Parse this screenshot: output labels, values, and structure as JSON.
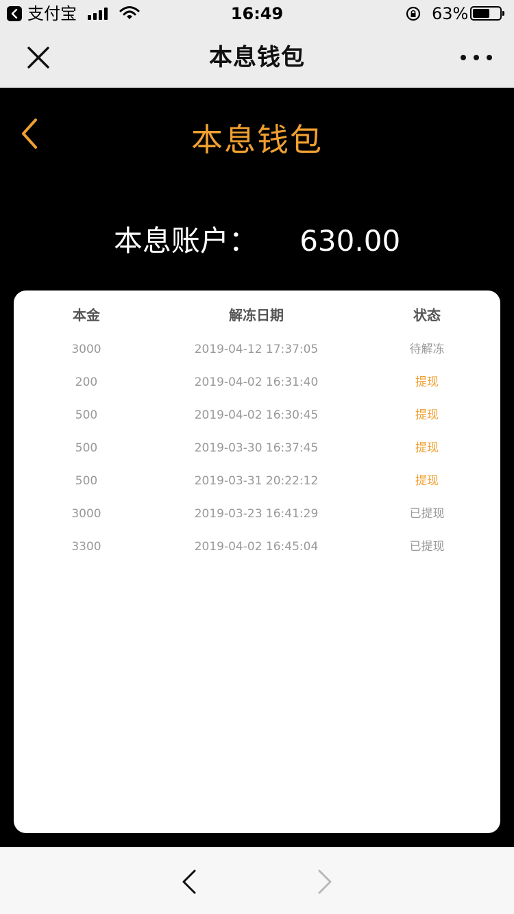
{
  "status_bar": {
    "app_name": "支付宝",
    "time": "16:49",
    "battery_percent": "63%",
    "battery_level": 0.63
  },
  "nav": {
    "title": "本息钱包"
  },
  "page": {
    "title": "本息钱包",
    "account_label": "本息账户：",
    "account_value": "630.00"
  },
  "table": {
    "headers": [
      "本金",
      "解冻日期",
      "状态"
    ],
    "rows": [
      {
        "principal": "3000",
        "date": "2019-04-12 17:37:05",
        "status": "待解冻",
        "status_color": "#999999"
      },
      {
        "principal": "200",
        "date": "2019-04-02 16:31:40",
        "status": "提现",
        "status_color": "#f0a030"
      },
      {
        "principal": "500",
        "date": "2019-04-02 16:30:45",
        "status": "提现",
        "status_color": "#f0a030"
      },
      {
        "principal": "500",
        "date": "2019-03-30 16:37:45",
        "status": "提现",
        "status_color": "#f0a030"
      },
      {
        "principal": "500",
        "date": "2019-03-31 20:22:12",
        "status": "提现",
        "status_color": "#f0a030"
      },
      {
        "principal": "3000",
        "date": "2019-03-23 16:41:29",
        "status": "已提现",
        "status_color": "#999999"
      },
      {
        "principal": "3300",
        "date": "2019-04-02 16:45:04",
        "status": "已提现",
        "status_color": "#999999"
      }
    ]
  },
  "colors": {
    "accent": "#f0a030",
    "page_background": "#000000",
    "bar_background": "#ececec"
  },
  "icons": {
    "status_back": "back-to-app-icon",
    "close": "close-icon",
    "more": "more-icon",
    "page_back": "chevron-left-icon",
    "browser_back": "browser-back-icon",
    "browser_forward": "browser-forward-icon"
  }
}
